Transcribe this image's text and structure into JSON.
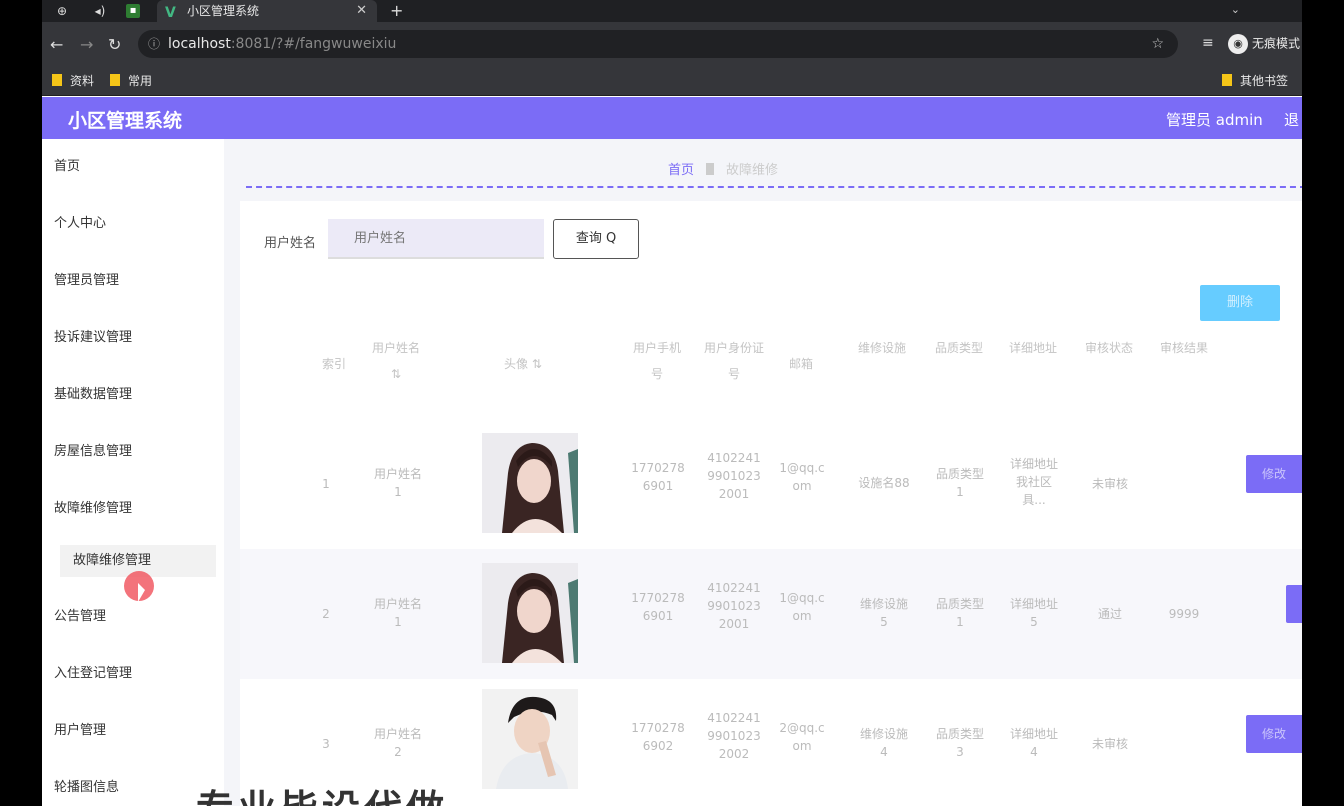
{
  "browser": {
    "tab_title": "小区管理系统",
    "url_host": "localhost",
    "url_rest": ":8081/?#/fangwuweixiu",
    "incognito_label": "无痕模式",
    "bookmarks": [
      "资料",
      "常用"
    ],
    "other_bookmarks": "其他书签"
  },
  "header": {
    "title": "小区管理系统",
    "user": "管理员 admin",
    "logout": "退"
  },
  "sidebar": {
    "items": [
      "首页",
      "个人中心",
      "管理员管理",
      "投诉建议管理",
      "基础数据管理",
      "房屋信息管理",
      "故障维修管理",
      "公告管理",
      "入住登记管理",
      "用户管理",
      "轮播图信息"
    ],
    "sub_item": "故障维修管理"
  },
  "main": {
    "breadcrumb_home": "首页",
    "breadcrumb_current": "故障维修",
    "search_label": "用户姓名",
    "search_placeholder": "用户姓名",
    "search_button": "查询 Q",
    "delete_button": "删除"
  },
  "table": {
    "headers": [
      "索引",
      "用户姓名",
      "头像",
      "用户手机号",
      "用户身份证号",
      "邮箱",
      "维修设施",
      "品质类型",
      "详细地址",
      "审核状态",
      "审核结果"
    ],
    "rows": [
      {
        "index": "1",
        "name": [
          "用户姓名",
          "1"
        ],
        "phone": [
          "1770278",
          "6901"
        ],
        "idcard": [
          "4102241",
          "9901023",
          "2001"
        ],
        "email": [
          "1@qq.c",
          "om"
        ],
        "facility": [
          "设施名88"
        ],
        "type": [
          "品质类型",
          "1"
        ],
        "address": [
          "详细地址",
          "我社区",
          "具..."
        ],
        "status": "未审核",
        "result": "",
        "action": "修改"
      },
      {
        "index": "2",
        "name": [
          "用户姓名",
          "1"
        ],
        "phone": [
          "1770278",
          "6901"
        ],
        "idcard": [
          "4102241",
          "9901023",
          "2001"
        ],
        "email": [
          "1@qq.c",
          "om"
        ],
        "facility": [
          "维修设施",
          "5"
        ],
        "type": [
          "品质类型",
          "1"
        ],
        "address": [
          "详细地址",
          "5"
        ],
        "status": "通过",
        "result": "9999",
        "action": ""
      },
      {
        "index": "3",
        "name": [
          "用户姓名",
          "2"
        ],
        "phone": [
          "1770278",
          "6902"
        ],
        "idcard": [
          "4102241",
          "9901023",
          "2002"
        ],
        "email": [
          "2@qq.c",
          "om"
        ],
        "facility": [
          "维修设施",
          "4"
        ],
        "type": [
          "品质类型",
          "3"
        ],
        "address": [
          "详细地址",
          "4"
        ],
        "status": "未审核",
        "result": "",
        "action": "修改"
      }
    ]
  },
  "watermark": "专业毕设代做"
}
